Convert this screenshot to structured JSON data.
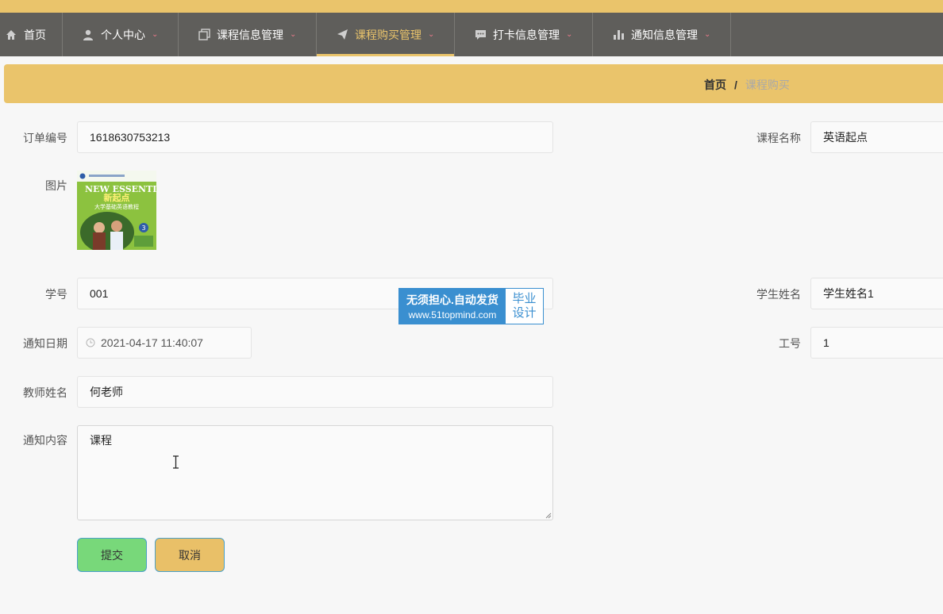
{
  "nav": {
    "items": [
      {
        "label": "首页",
        "icon": "home-icon"
      },
      {
        "label": "个人中心",
        "icon": "user-icon"
      },
      {
        "label": "课程信息管理",
        "icon": "copy-icon"
      },
      {
        "label": "课程购买管理",
        "icon": "send-icon"
      },
      {
        "label": "打卡信息管理",
        "icon": "chat-icon"
      },
      {
        "label": "通知信息管理",
        "icon": "bar-chart-icon"
      }
    ],
    "active_index": 3
  },
  "breadcrumb": {
    "home": "首页",
    "separator": "/",
    "current": "课程购买"
  },
  "form": {
    "order_no": {
      "label": "订单编号",
      "value": "1618630753213"
    },
    "course_name": {
      "label": "课程名称",
      "value": "英语起点"
    },
    "image": {
      "label": "图片"
    },
    "student_no": {
      "label": "学号",
      "value": "001"
    },
    "student_name": {
      "label": "学生姓名",
      "value": "学生姓名1"
    },
    "notice_date": {
      "label": "通知日期",
      "value": "2021-04-17 11:40:07"
    },
    "work_no": {
      "label": "工号",
      "value": "1"
    },
    "teacher_name": {
      "label": "教师姓名",
      "value": "何老师"
    },
    "notice_content": {
      "label": "通知内容",
      "value": "课程"
    },
    "submit_label": "提交",
    "cancel_label": "取消"
  },
  "cover": {
    "brand": "NEW ESSENTIAL",
    "title": "新起点",
    "subtitle": "大学基础英语教程",
    "number": "3"
  },
  "watermark": {
    "line1": "无须担心.自动发货",
    "line2": "www.51topmind.com",
    "right1": "毕业",
    "right2": "设计"
  },
  "colors": {
    "accent": "#eac46b",
    "nav_bg": "#5f5e5b",
    "caret": "#e9798a",
    "submit": "#78d87a",
    "cancel": "#e9c068"
  }
}
